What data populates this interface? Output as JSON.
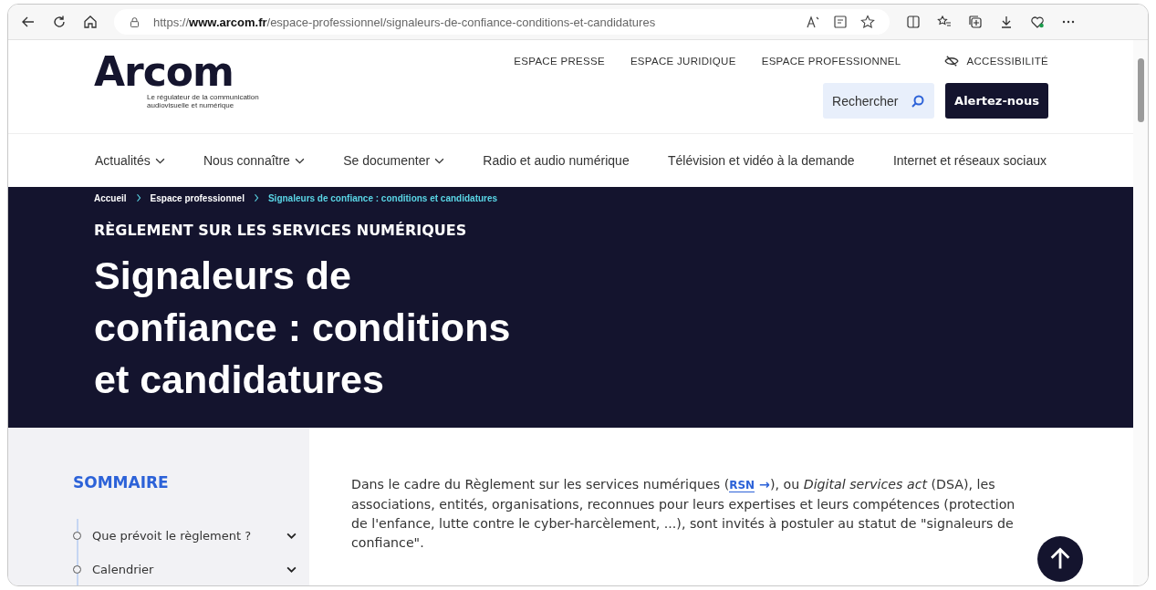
{
  "browser": {
    "url": "https://**www.arcom.fr**/espace-professionnel/signaleurs-de-confiance-conditions-et-candidatures"
  },
  "header": {
    "logo": "Arcom",
    "tagline": "Le régulateur de la communication audiovisuelle et numérique",
    "top_links": [
      {
        "label": "ESPACE PRESSE",
        "kind": "link"
      },
      {
        "label": "ESPACE JURIDIQUE",
        "kind": "link"
      },
      {
        "label": "ESPACE PROFESSIONNEL",
        "kind": "link"
      },
      {
        "label": "ACCESSIBILITÉ",
        "kind": "accessibility"
      }
    ],
    "search": {
      "placeholder": "Rechercher"
    },
    "alert_button": "Alertez-nous"
  },
  "nav": [
    {
      "label": "Actualités",
      "kind": "menu"
    },
    {
      "label": "Nous connaître",
      "kind": "menu"
    },
    {
      "label": "Se documenter",
      "kind": "menu"
    },
    {
      "label": "Radio et audio numérique",
      "kind": "link"
    },
    {
      "label": "Télévision et vidéo à la demande",
      "kind": "link"
    },
    {
      "label": "Internet et réseaux sociaux",
      "kind": "link"
    }
  ],
  "hero": {
    "breadcrumb": [
      {
        "label": "Accueil",
        "selected": false
      },
      {
        "label": "Espace professionnel",
        "selected": false
      },
      {
        "label": "Signaleurs de confiance : conditions et candidatures",
        "selected": true
      }
    ],
    "eyebrow": "RÈGLEMENT SUR LES SERVICES NUMÉRIQUES",
    "title_lines": [
      "Signaleurs de",
      "confiance : conditions",
      "et candidatures"
    ]
  },
  "sommaire": {
    "title": "SOMMAIRE",
    "items": [
      "Que prévoit le règlement ?",
      "Calendrier"
    ]
  },
  "intro": {
    "before": "Dans le cadre du Règlement sur les services numériques (",
    "link": "RSN",
    "link_arrow": "→",
    "after": "), ou *Digital services act* (DSA), les associations, entités, organisations, reconnues pour leurs expertises et leurs compétences (protection de l'enfance, lutte contre le cyber-harcèlement, ...), sont invités à postuler au statut de \"signaleurs de confiance\"."
  }
}
